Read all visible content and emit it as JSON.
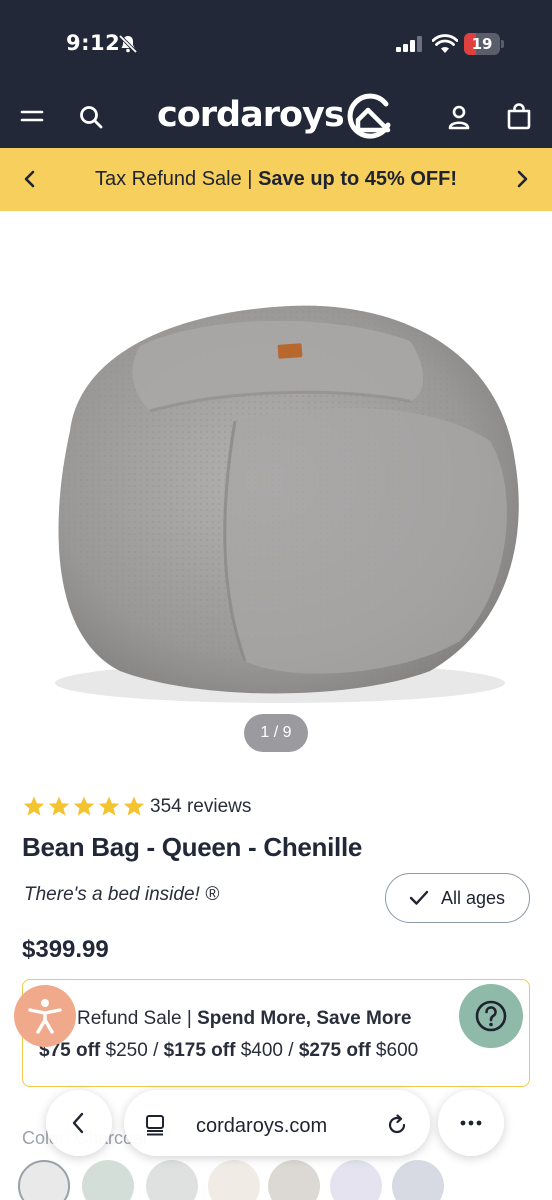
{
  "status_bar": {
    "time": "9:12",
    "battery": "19"
  },
  "header": {
    "brand": "cordaroys"
  },
  "promo": {
    "text_prefix": "Tax Refund Sale | ",
    "text_bold": "Save up to 45% OFF!"
  },
  "gallery": {
    "pager": "1 / 9"
  },
  "product": {
    "rating": 5,
    "reviews": "354 reviews",
    "title": "Bean Bag - Queen - Chenille",
    "tagline": "There's a bed inside! ®",
    "age_badge": "All ages",
    "price": "$399.99"
  },
  "sale_box": {
    "line1_prefix": "Refund Sale | ",
    "line1_bold": "Spend More, Save More",
    "tiers": [
      {
        "off": "$75 off",
        "min": " $250"
      },
      {
        "off": "$175 off",
        "min": " $400"
      },
      {
        "off": "$275 off",
        "min": " $600"
      }
    ],
    "separator": " / "
  },
  "options": {
    "color_label": "Color: Charcoal",
    "swatches": [
      "#e9e9ea",
      "#d3ded9",
      "#dfe1e0",
      "#f0ece5",
      "#dcd9d4",
      "#e4e3ef",
      "#d7dae2"
    ]
  },
  "browser": {
    "url": "cordaroys.com"
  },
  "colors": {
    "navy": "#232838",
    "promo": "#f6cf5d",
    "accent_border": "#f2c94c"
  },
  "icons": [
    "bell-muted-icon",
    "signal-icon",
    "wifi-icon",
    "battery-icon",
    "menu-icon",
    "search-icon",
    "logo-mark-icon",
    "account-icon",
    "bag-icon",
    "chevron-left-icon",
    "chevron-right-icon",
    "star-icon",
    "check-icon",
    "accessibility-icon",
    "help-icon",
    "back-icon",
    "tabs-icon",
    "reload-icon",
    "more-icon"
  ]
}
